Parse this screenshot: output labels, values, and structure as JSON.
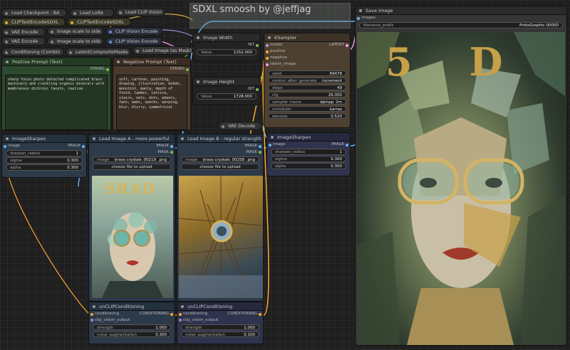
{
  "header_note": "SDXL smoosh by @jeffjag",
  "mini_nodes": {
    "load_checkpoint": "Load Checkpoint - BA",
    "load_lora": "Load LoRA",
    "load_clip_vision": "Load CLIP Vision",
    "clip_text_encode_sdxl_1": "CLIPTextEncodeSDXL",
    "clip_text_encode_sdxl_2": "CLIPTextEncodeSDXL",
    "vae_encode_1": "VAE Encode",
    "image_scale_1": "Image scale to side",
    "clip_vision_encode_1": "CLIP Vision Encode",
    "vae_encode_2": "VAE Encode",
    "image_scale_2": "Image scale to side",
    "clip_vision_encode_2": "CLIP Vision Encode",
    "conditioning_combine": "Conditioning (Combin",
    "latent_composite": "LatentCompositeMaske",
    "load_image_mask": "Load Image (as Mask)",
    "vae_decode": "VAE Decode"
  },
  "positive_prompt": {
    "title": "Positive Prompt (Text)",
    "out": "STRING",
    "text": "sharp focus photo detailed complicated brass machinery and crackling organic minerals with membranous dichroic facets, realism"
  },
  "negative_prompt": {
    "title": "Negative Prompt (Text)",
    "out": "STRING",
    "text": "soft, cartoon, painting, drawing, illustration, bokeh, monotint, manly, depth of field, ladder, lattice, stairs, nets, dots, wheels, fans, webs, specks, warping, blur, blurry, symmetrical"
  },
  "image_width": {
    "title": "Image Width",
    "out": "INT",
    "label": "Value",
    "value": "1152.000"
  },
  "image_height": {
    "title": "Image Height",
    "out": "INT",
    "label": "Value",
    "value": "1728.000"
  },
  "ksampler": {
    "title": "KSampler",
    "inputs": [
      "model",
      "positive",
      "negative",
      "latent_image"
    ],
    "out": "LATENT",
    "widgets": [
      {
        "label": "seed",
        "value": "69478"
      },
      {
        "label": "control_after_generate",
        "value": "increment"
      },
      {
        "label": "steps",
        "value": "49"
      },
      {
        "label": "cfg",
        "value": "26.000"
      },
      {
        "label": "sampler_name",
        "value": "dpmpp_2m"
      },
      {
        "label": "scheduler",
        "value": "karras"
      },
      {
        "label": "denoise",
        "value": "0.520"
      }
    ]
  },
  "save_image": {
    "title": "Save Image",
    "input": "images",
    "prefix_label": "filename_prefix",
    "prefix_value": "ProtoGraphic 00000"
  },
  "sharpen_1": {
    "title": "ImageSharpen",
    "in": "image",
    "out": "IMAGE",
    "widgets": [
      {
        "label": "sharpen_radius",
        "value": "1"
      },
      {
        "label": "sigma",
        "value": "0.300"
      },
      {
        "label": "alpha",
        "value": "0.300"
      }
    ]
  },
  "sharpen_2": {
    "title": "ImageSharpen",
    "in": "image",
    "out": "IMAGE",
    "widgets": [
      {
        "label": "sharpen_radius",
        "value": "1"
      },
      {
        "label": "sigma",
        "value": "0.300"
      },
      {
        "label": "alpha",
        "value": "0.300"
      }
    ]
  },
  "load_a": {
    "title": "Load Image A - more powerful",
    "outs": [
      "IMAGE",
      "MASK"
    ],
    "image_label": "image",
    "image_value": "brass crystals_00219_.png",
    "upload": "choose file to upload",
    "art_text": "SRAD"
  },
  "load_b": {
    "title": "Load Image B - regular strength",
    "outs": [
      "IMAGE",
      "MASK"
    ],
    "image_label": "image",
    "image_value": "brass crystals_00258_.png",
    "upload": "choose file to upload"
  },
  "unclip_1": {
    "title": "unCLIPConditioning",
    "ins": [
      "conditioning",
      "clip_vision_output"
    ],
    "out": "CONDITIONING",
    "widgets": [
      {
        "label": "strength",
        "value": "1.000"
      },
      {
        "label": "noise_augmentation",
        "value": "0.300"
      }
    ]
  },
  "unclip_2": {
    "title": "unCLIPConditioning",
    "ins": [
      "conditioning",
      "clip_vision_output"
    ],
    "out": "CONDITIONING",
    "widgets": [
      {
        "label": "strength",
        "value": "1.000"
      },
      {
        "label": "noise_augmentation",
        "value": "0.100"
      }
    ]
  },
  "output_art_text": "5D",
  "colors": {
    "image_wire": "#64b5f6",
    "latent_wire": "#ff9cf9",
    "cond_wire": "#ffa931",
    "int_wire": "#7cbf4a",
    "green_node": "#2e4a2e",
    "brown_node": "#4a3a2e",
    "ksampler": "#4d4030",
    "blue_node": "#30334d"
  }
}
